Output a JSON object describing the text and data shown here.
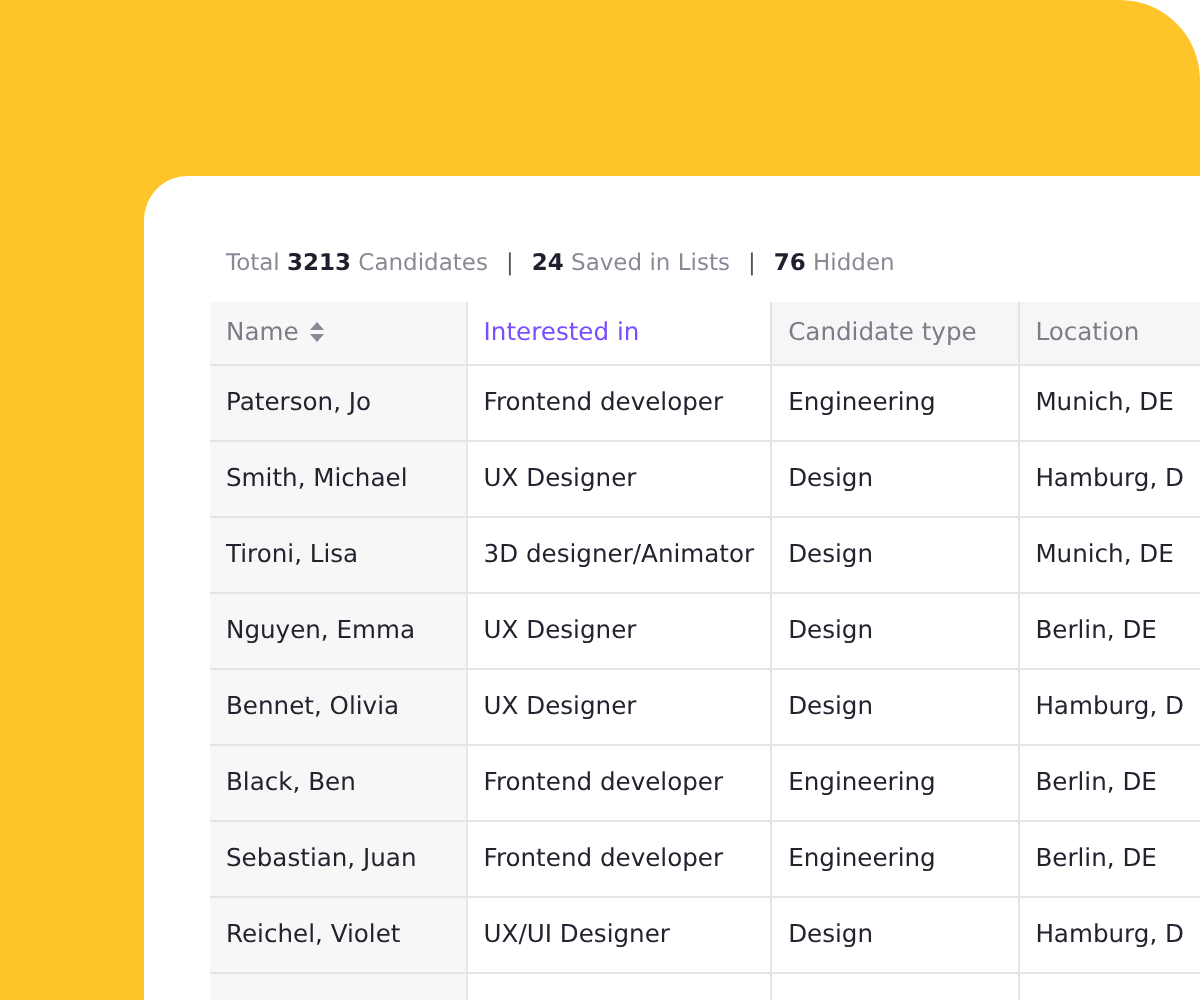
{
  "summary": [
    {
      "kind": "text",
      "text": "Total **3213** Candidates"
    },
    {
      "kind": "separator",
      "text": "|"
    },
    {
      "kind": "text",
      "text": "**24** Saved in Lists"
    },
    {
      "kind": "separator",
      "text": "|"
    },
    {
      "kind": "text",
      "text": "**76** Hidden"
    }
  ],
  "table": {
    "columns": [
      {
        "label": "Name",
        "sort_icon": true,
        "selected": false
      },
      {
        "label": "Interested in",
        "sort_icon": false,
        "selected": true
      },
      {
        "label": "Candidate type",
        "sort_icon": false,
        "selected": false
      },
      {
        "label": "Location",
        "sort_icon": false,
        "selected": false
      }
    ],
    "rows": [
      [
        "Paterson, Jo",
        "Frontend developer",
        "Engineering",
        "Munich, DE"
      ],
      [
        "Smith, Michael",
        "UX Designer",
        "Design",
        "Hamburg, D"
      ],
      [
        "Tironi, Lisa",
        "3D designer/Animator",
        "Design",
        "Munich, DE"
      ],
      [
        "Nguyen, Emma",
        "UX Designer",
        "Design",
        "Berlin, DE"
      ],
      [
        "Bennet, Olivia",
        "UX Designer",
        "Design",
        "Hamburg, D"
      ],
      [
        "Black, Ben",
        "Frontend developer",
        "Engineering",
        "Berlin, DE"
      ],
      [
        "Sebastian, Juan",
        "Frontend developer",
        "Engineering",
        "Berlin, DE"
      ],
      [
        "Reichel, Violet",
        "UX/UI Designer",
        "Design",
        "Hamburg, D"
      ]
    ]
  }
}
